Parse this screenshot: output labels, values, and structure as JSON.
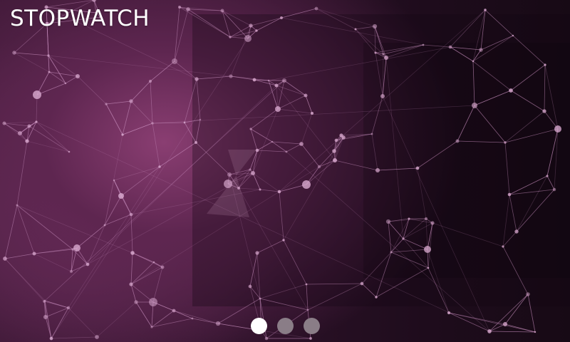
{
  "app": {
    "title": "STOPWATCH"
  },
  "pager": {
    "page_count": 3,
    "active_index": 0,
    "active_color": "#ffffff",
    "inactive_color": "#8a7d87"
  },
  "background": {
    "style": "network-mesh",
    "base_color": "#2c1128",
    "highlight_color": "#8a3e72",
    "line_color": "#c98fbf"
  }
}
